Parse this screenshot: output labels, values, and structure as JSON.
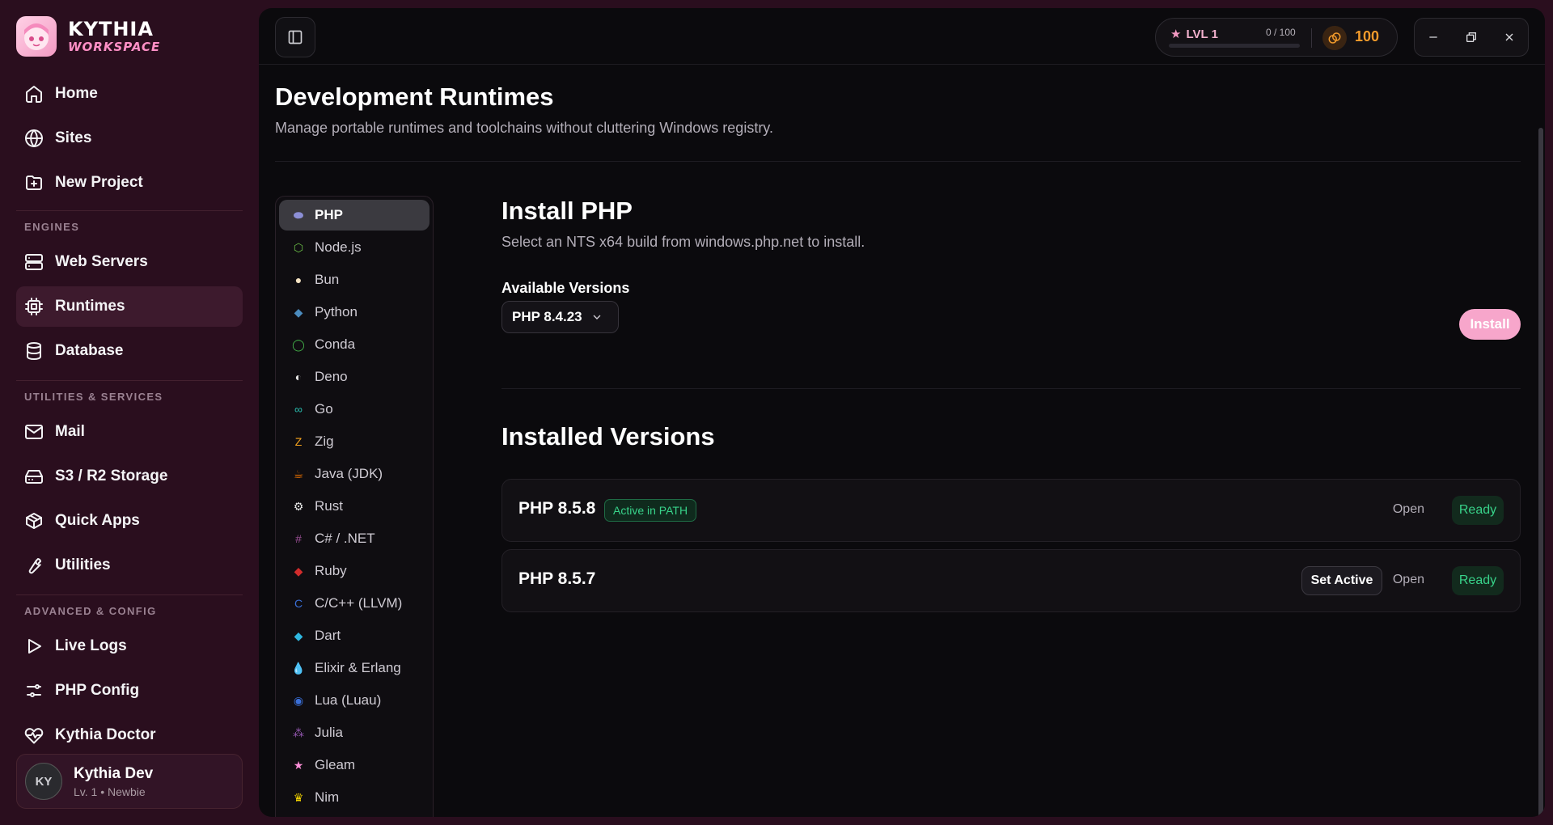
{
  "brand": {
    "title": "KYTHIA",
    "subtitle": "WORKSPACE"
  },
  "nav": {
    "home": "Home",
    "sites": "Sites",
    "new_project": "New Project",
    "engines_label": "ENGINES",
    "web_servers": "Web Servers",
    "runtimes": "Runtimes",
    "database": "Database",
    "utilities_label": "UTILITIES & SERVICES",
    "mail": "Mail",
    "storage": "S3 / R2 Storage",
    "quick_apps": "Quick Apps",
    "utilities": "Utilities",
    "advanced_label": "ADVANCED & CONFIG",
    "live_logs": "Live Logs",
    "php_config": "PHP Config",
    "doctor": "Kythia Doctor"
  },
  "user": {
    "initials": "KY",
    "name": "Kythia Dev",
    "meta": "Lv. 1 • Newbie"
  },
  "topbar": {
    "level": "LVL 1",
    "xp": "0 / 100",
    "xp_fraction": 0.0,
    "coins": "100"
  },
  "page": {
    "title": "Development Runtimes",
    "subtitle": "Manage portable runtimes and toolchains without cluttering Windows registry."
  },
  "runtimes": [
    {
      "label": "PHP",
      "icon": "php-icon"
    },
    {
      "label": "Node.js",
      "icon": "nodejs-icon"
    },
    {
      "label": "Bun",
      "icon": "bun-icon"
    },
    {
      "label": "Python",
      "icon": "python-icon"
    },
    {
      "label": "Conda",
      "icon": "conda-icon"
    },
    {
      "label": "Deno",
      "icon": "deno-icon"
    },
    {
      "label": "Go",
      "icon": "go-icon"
    },
    {
      "label": "Zig",
      "icon": "zig-icon"
    },
    {
      "label": "Java (JDK)",
      "icon": "java-icon"
    },
    {
      "label": "Rust",
      "icon": "rust-icon"
    },
    {
      "label": "C# / .NET",
      "icon": "csharp-icon"
    },
    {
      "label": "Ruby",
      "icon": "ruby-icon"
    },
    {
      "label": "C/C++ (LLVM)",
      "icon": "cpp-icon"
    },
    {
      "label": "Dart",
      "icon": "dart-icon"
    },
    {
      "label": "Elixir & Erlang",
      "icon": "elixir-icon"
    },
    {
      "label": "Lua (Luau)",
      "icon": "lua-icon"
    },
    {
      "label": "Julia",
      "icon": "julia-icon"
    },
    {
      "label": "Gleam",
      "icon": "gleam-icon"
    },
    {
      "label": "Nim",
      "icon": "nim-icon"
    }
  ],
  "install": {
    "title": "Install PHP",
    "subtitle": "Select an NTS x64 build from windows.php.net to install.",
    "available_label": "Available Versions",
    "selected_version": "PHP 8.4.23",
    "button": "Install"
  },
  "installed": {
    "title": "Installed Versions",
    "items": [
      {
        "name": "PHP 8.5.8",
        "badge": "Active in PATH",
        "open": "Open",
        "status": "Ready"
      },
      {
        "name": "PHP 8.5.7",
        "action": "Set Active",
        "open": "Open",
        "status": "Ready"
      }
    ]
  },
  "colors": {
    "accent": "#f7a6cb",
    "sidebar_bg": "#2a0e1e",
    "main_bg": "#0b0a0d",
    "ready": "#38d38a",
    "coin": "#f39b2b"
  }
}
